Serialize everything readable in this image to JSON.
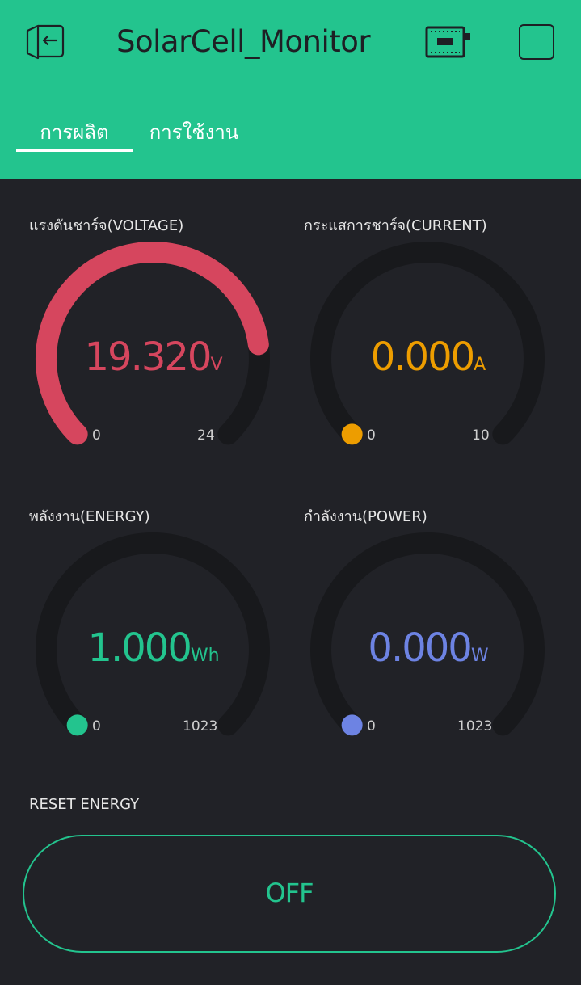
{
  "app": {
    "title": "SolarCell_Monitor"
  },
  "header": {
    "icons": {
      "back": "exit-icon",
      "device": "hardware-device-icon",
      "square": "square-outline-icon"
    }
  },
  "tabs": [
    {
      "label": "การผลิต",
      "active": true
    },
    {
      "label": "การใช้งาน",
      "active": false
    }
  ],
  "gauges": [
    {
      "label": "แรงดันชาร์จ(VOLTAGE)",
      "value": "19.320",
      "unit": "V",
      "min": "0",
      "max": "24",
      "color": "#d6465e",
      "fraction": 0.805
    },
    {
      "label": "กระแสการชาร์จ(CURRENT)",
      "value": "0.000",
      "unit": "A",
      "min": "0",
      "max": "10",
      "color": "#ed9d00",
      "fraction": 0
    },
    {
      "label": "พลังงาน(ENERGY)",
      "value": "1.000",
      "unit": "Wh",
      "min": "0",
      "max": "1023",
      "color": "#23c48e",
      "fraction": 0.001
    },
    {
      "label": "กำลังงาน(POWER)",
      "value": "0.000",
      "unit": "W",
      "min": "0",
      "max": "1023",
      "color": "#6d83e3",
      "fraction": 0
    }
  ],
  "reset": {
    "label": "RESET ENERGY",
    "button_label": "OFF",
    "color": "#23c48e"
  },
  "colors": {
    "header_bg": "#23c48e",
    "page_bg": "#212227",
    "gauge_track": "#18191c"
  }
}
